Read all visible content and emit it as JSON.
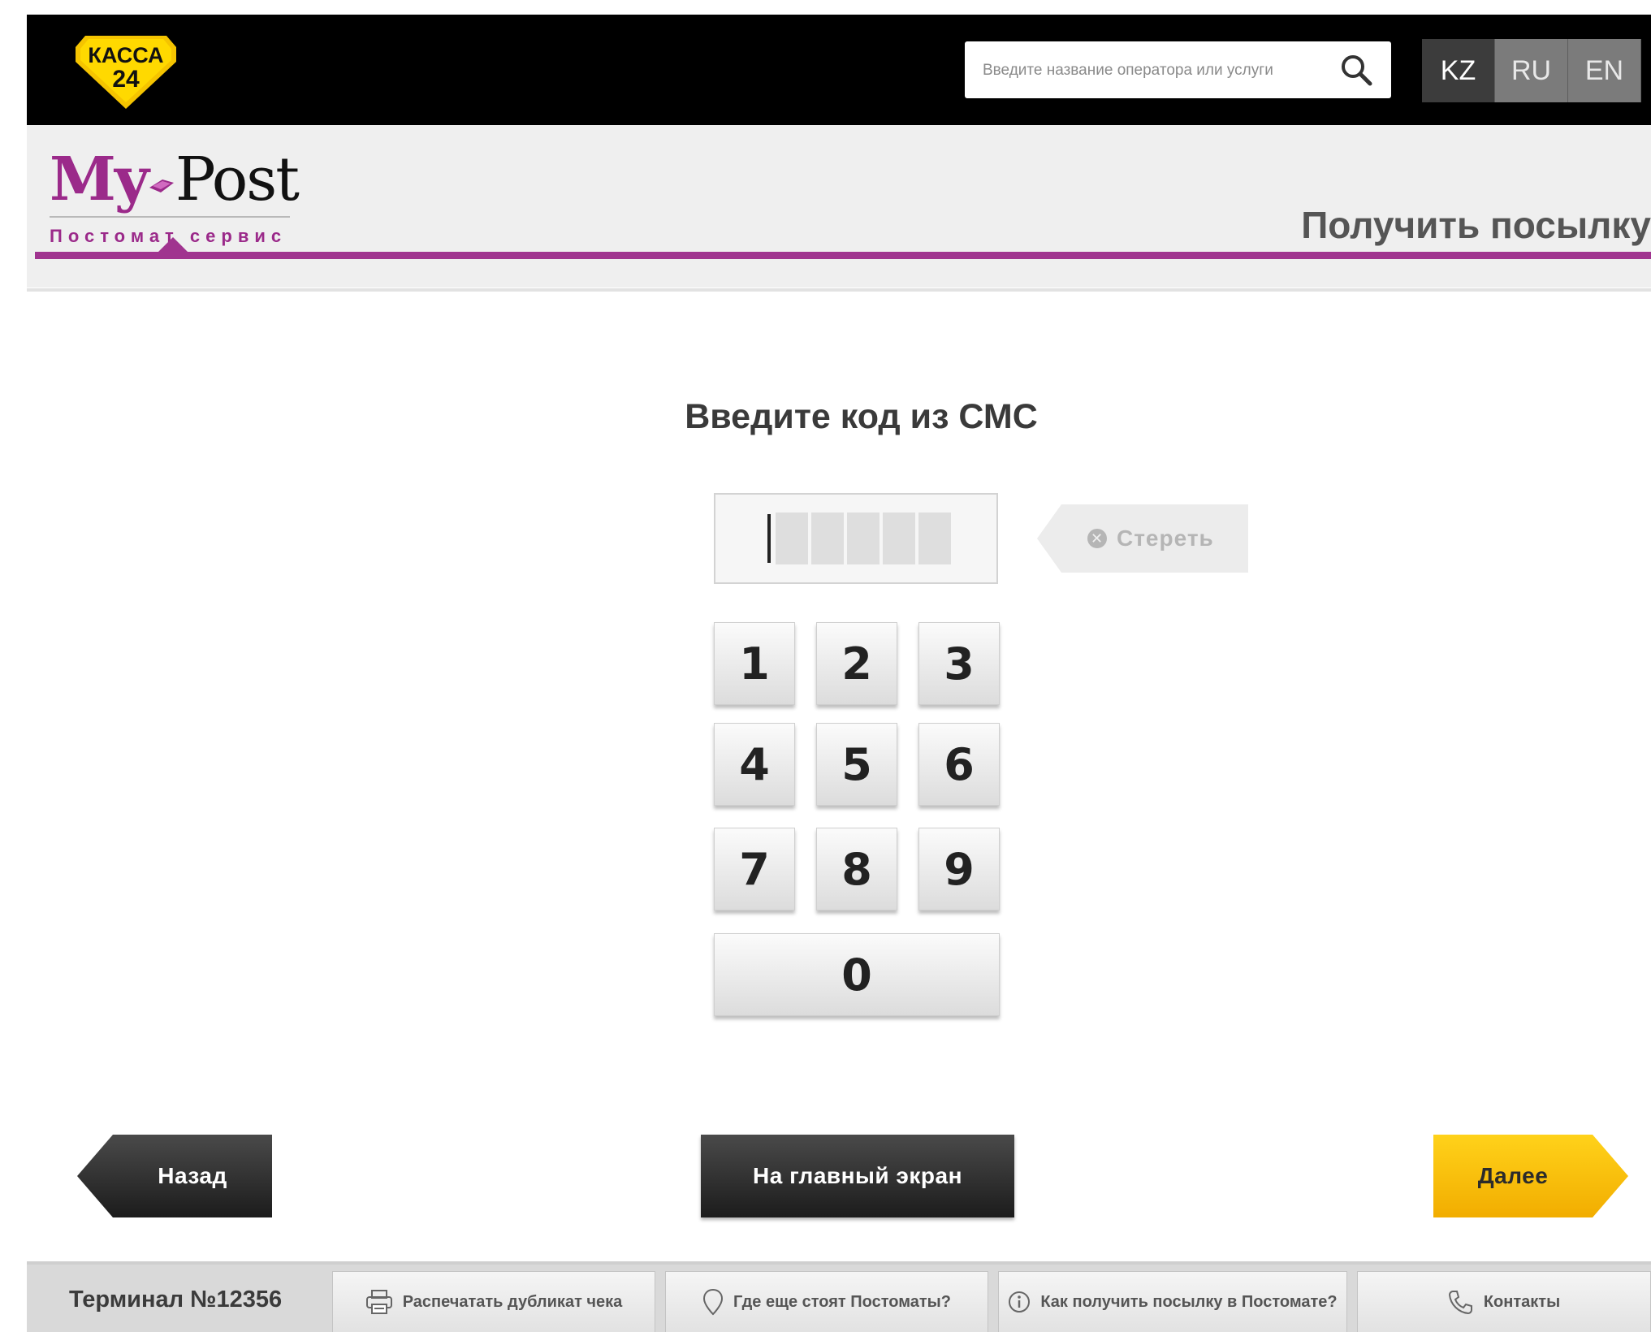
{
  "topbar": {
    "logo_text_line1": "КАССА",
    "logo_text_line2": "24",
    "search_placeholder": "Введите название оператора или услуги",
    "languages": [
      "KZ",
      "RU",
      "EN"
    ],
    "active_language": "KZ"
  },
  "header": {
    "brand_my": "My",
    "brand_post": "Post",
    "brand_subtitle": "Постомат сервис",
    "page_title": "Получить посылку"
  },
  "main": {
    "prompt": "Введите код из СМС",
    "code_value": "",
    "erase_label": "Стереть",
    "keypad": [
      "1",
      "2",
      "3",
      "4",
      "5",
      "6",
      "7",
      "8",
      "9",
      "0"
    ]
  },
  "nav": {
    "back_label": "Назад",
    "home_label": "На главный экран",
    "next_label": "Далее"
  },
  "footer": {
    "terminal": "Терминал №12356",
    "buttons": [
      {
        "label": "Распечатать дубликат чека",
        "icon": "printer-icon"
      },
      {
        "label": "Где еще стоят Постоматы?",
        "icon": "location-pin-icon"
      },
      {
        "label": "Как получить посылку в Постомате?",
        "icon": "info-icon"
      },
      {
        "label": "Контакты",
        "icon": "phone-icon"
      }
    ]
  },
  "colors": {
    "brand_purple": "#a0348f",
    "next_yellow": "#f5b800",
    "topbar_black": "#000000"
  }
}
